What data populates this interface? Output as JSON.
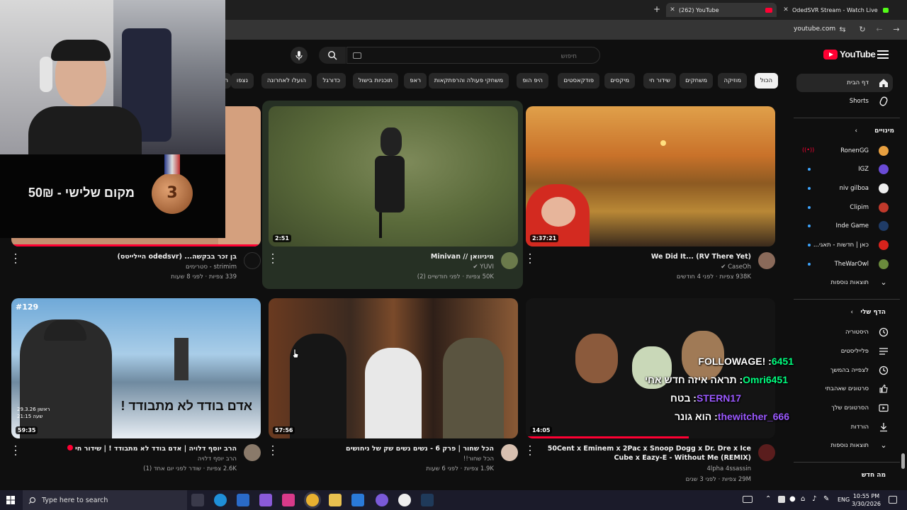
{
  "browser": {
    "tabs": [
      {
        "title": "(262) YouTube"
      },
      {
        "title": "OdedSVR Stream - Watch Live ..."
      }
    ],
    "url": "youtube.com"
  },
  "header": {
    "logo_text": "YouTube",
    "search_placeholder": "חיפוש"
  },
  "chips": [
    "הכול",
    "מוזיקה",
    "משחקים",
    "שידור חי",
    "מיקסים",
    "פודקאסטים",
    "היפ הופ",
    "משחקי פעולה והרפתקאות",
    "ראפ",
    "תוכניות בישול",
    "כדורגל",
    "הועלו לאחרונה",
    "נצפו",
    "ח"
  ],
  "sidebar": {
    "home": "דף הבית",
    "shorts": "Shorts",
    "subscriptions_header": "מינויים",
    "subscriptions": [
      {
        "name": "RonenGG",
        "color": "#e8a040"
      },
      {
        "name": "IGZ",
        "color": "#6a4bd6"
      },
      {
        "name": "niv gilboa",
        "color": "#eeeeee"
      },
      {
        "name": "Clipim",
        "color": "#c0392b"
      },
      {
        "name": "Inde Game",
        "color": "#1f3b66"
      },
      {
        "name": "כאן | חדשות - תאגי...",
        "color": "#d8231c"
      },
      {
        "name": "TheWarOwl",
        "color": "#6a8a3c"
      }
    ],
    "show_more_1": "תוצאות נוספות",
    "you_header": "הדף שלי",
    "you_items": [
      "היסטוריה",
      "פלייליסטים",
      "לצפייה בהמשך",
      "סרטונים שאהבתי",
      "הסרטונים שלך",
      "הורדות"
    ],
    "show_more_2": "תוצאות נוספות",
    "whats_new": "מה חדש"
  },
  "videos": [
    {
      "title": "We Did It... (RV There Yet)",
      "channel": "CaseOh",
      "meta": "938K צפיות · לפני 4 חודשים",
      "duration": "2:37:21",
      "verified": true
    },
    {
      "title": "מיניוואן // Minivan",
      "channel": "YUVI",
      "meta": "50K צפיות · לפני חודשיים (2)",
      "duration": "2:51",
      "verified": true
    },
    {
      "title": "בן זכר בבקשה... (odedsvr היילייטס)",
      "channel": "strimim - סטרימים",
      "meta": "339 צפיות · לפני 8 שעות",
      "duration": "",
      "verified": false
    },
    {
      "title": "50Cent x Eminem x 2Pac x Snoop Dogg x Dr. Dre x Ice Cube x Eazy-E  -  Without Me (REMIX)",
      "channel": "4lpha 4ssassin",
      "meta": "29M צפיות · לפני 3 שנים",
      "duration": "14:05",
      "verified": false
    },
    {
      "title": "הכל שחור | פרק 6 - נשים נשים שק של ניחושים",
      "channel": "הכל שחור!!",
      "meta": "1.9K צפיות · לפני 6 שעות",
      "duration": "57:56",
      "verified": false
    },
    {
      "title": "הרב יוסף דלויה | אדם בודד לא מתבודד ! | שידור חי",
      "channel": "הרב יוסף דלויה",
      "meta": "2.6K צפיות · שודר לפני יום אחד (1)",
      "duration": "59:35",
      "verified": false
    }
  ],
  "thumb_texts": {
    "episode": "#129",
    "headline": "אדם בודד לא מתבודד !",
    "date_line1": "ראשון 29.3.26",
    "date_line2": "שעה 21:15"
  },
  "overlay": {
    "banner_text": "מקום שלישי - 50₪",
    "medal_number": "3"
  },
  "chat": [
    {
      "user": "6451",
      "text": ": !FOLLOWAGE",
      "color": "#00ff7f"
    },
    {
      "user": "Omri6451",
      "text": ": תראה איזה חדש אחי",
      "color": "#00ff7f"
    },
    {
      "user": "STERN17",
      "text": ": בטח",
      "color": "#9b59ff"
    },
    {
      "user": "thewitcher_666",
      "text": ": הוא גונר",
      "color": "#9b59ff"
    }
  ],
  "taskbar": {
    "search_text": "Type here to search",
    "language": "ENG",
    "time": "10:55 PM",
    "date": "3/30/2026"
  }
}
